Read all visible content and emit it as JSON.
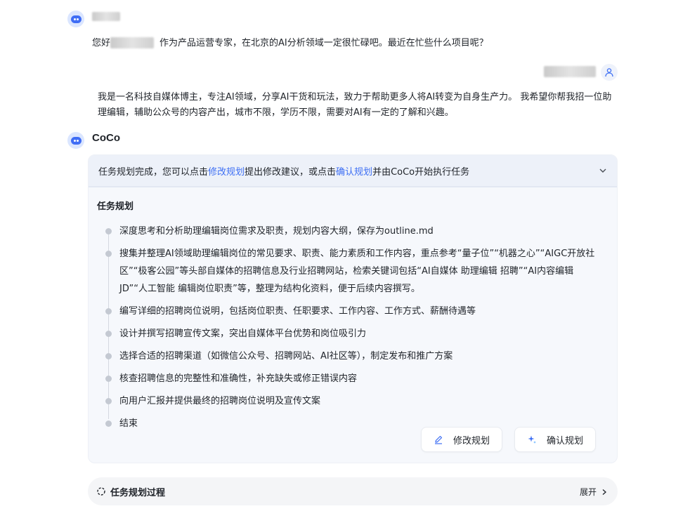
{
  "bot_greeting": {
    "prefix": "您好",
    "suffix": "作为产品运营专家，在北京的AI分析领域一定很忙碌吧。最近在忙些什么项目呢？"
  },
  "user_message": "我是一名科技自媒体博主，专注AI领域，分享AI干货和玩法，致力于帮助更多人将AI转变为自身生产力。 我希望你帮我招一位助理编辑，辅助公众号的内容产出，城市不限，学历不限，需要对AI有一定的了解和兴趣。",
  "assistant_name": "CoCo",
  "plan": {
    "header_prefix": "任务规划完成，您可以点击",
    "header_link_edit": "修改规划",
    "header_mid": "提出修改建议，或点击",
    "header_link_confirm": "确认规划",
    "header_suffix": "并由CoCo开始执行任务",
    "title": "任务规划",
    "steps": [
      "深度思考和分析助理编辑岗位需求及职责，规划内容大纲，保存为outline.md",
      "搜集并整理AI领域助理编辑岗位的常见要求、职责、能力素质和工作内容，重点参考“量子位”“机器之心”“AIGC开放社区”“极客公园”等头部自媒体的招聘信息及行业招聘网站，检索关键词包括“AI自媒体 助理编辑 招聘”“AI内容编辑 JD”“人工智能 编辑岗位职责”等，整理为结构化资料，便于后续内容撰写。",
      "编写详细的招聘岗位说明，包括岗位职责、任职要求、工作内容、工作方式、薪酬待遇等",
      "设计并撰写招聘宣传文案，突出自媒体平台优势和岗位吸引力",
      "选择合适的招聘渠道（如微信公众号、招聘网站、AI社区等），制定发布和推广方案",
      "核查招聘信息的完整性和准确性，补充缺失或修正错误内容",
      "向用户汇报并提供最终的招聘岗位说明及宣传文案",
      "结束"
    ],
    "edit_button": "修改规划",
    "confirm_button": "确认规划"
  },
  "process": {
    "label": "任务规划过程",
    "expand": "展开"
  },
  "colors": {
    "accent": "#3e6ff4",
    "card_bg": "#f6f8fc"
  }
}
